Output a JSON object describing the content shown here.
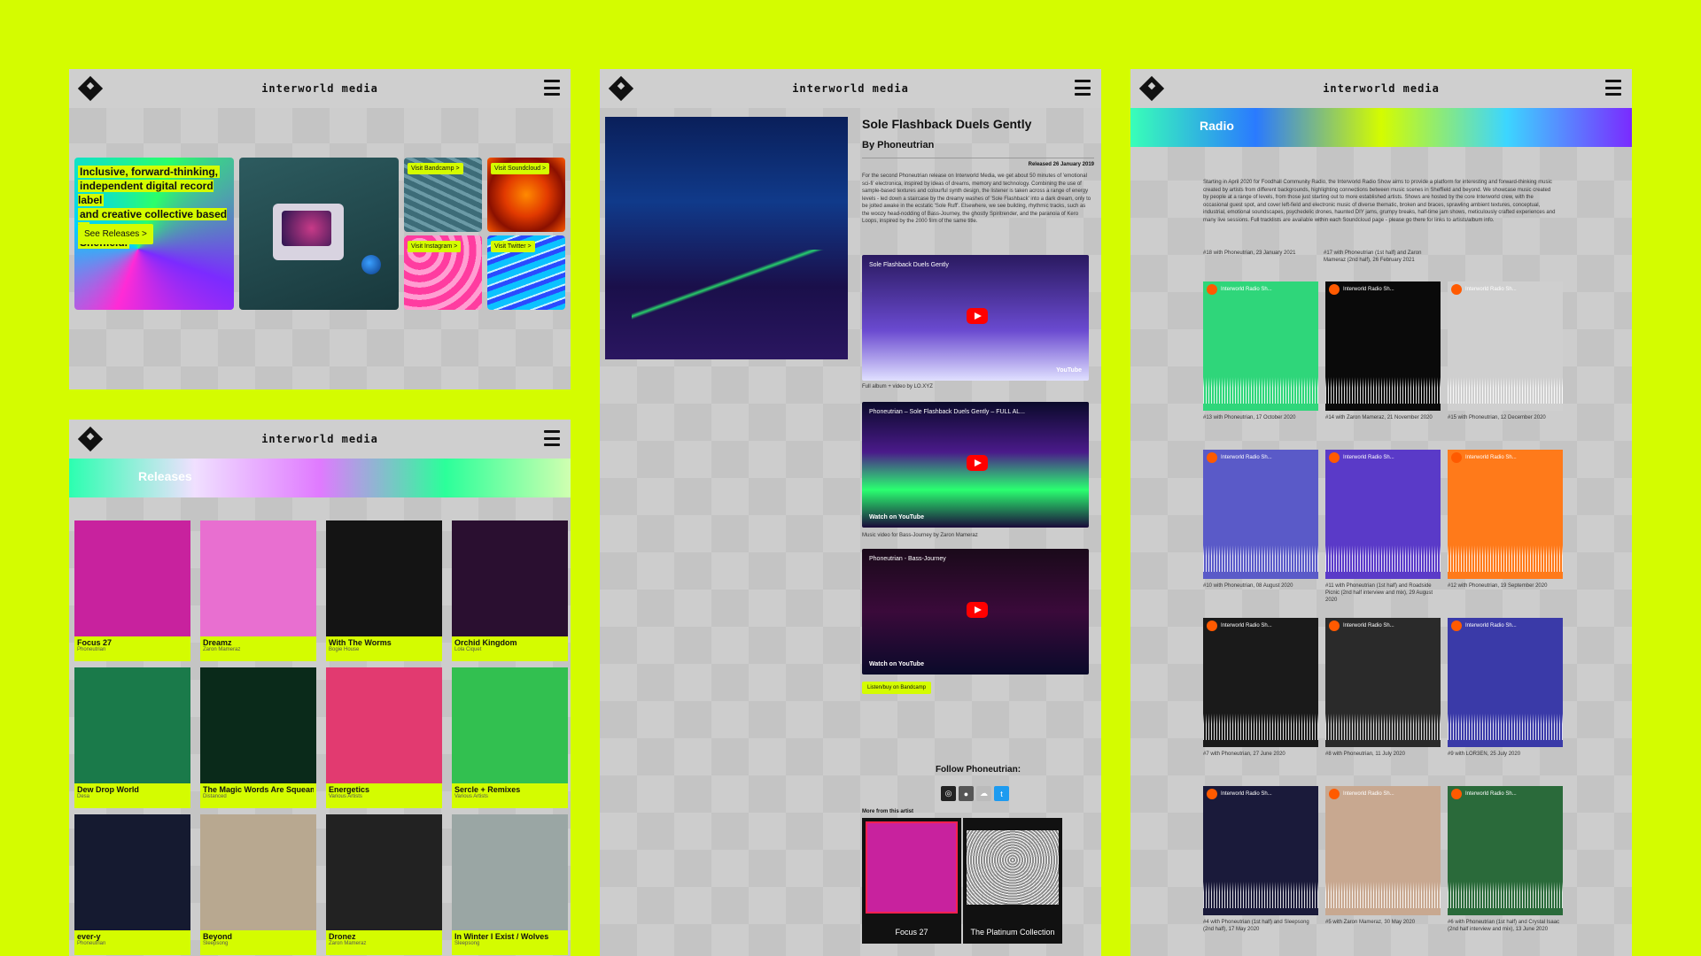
{
  "brand": "interworld media",
  "home": {
    "tagline_lines": [
      "Inclusive, forward-thinking,",
      "independent digital record label",
      "and creative collective based in",
      "Sheffield."
    ],
    "cta": "See Releases >",
    "links": {
      "bandcamp": "Visit Bandcamp >",
      "soundcloud": "Visit Soundcloud >",
      "instagram": "Visit Instagram >",
      "twitter": "Visit Twitter >"
    }
  },
  "releases": {
    "heading": "Releases",
    "items": [
      {
        "title": "Focus 27",
        "artist": "Phoneutrian",
        "color": "#c8229e"
      },
      {
        "title": "Dreamz",
        "artist": "Zaron Mameraz",
        "color": "#e86fd0"
      },
      {
        "title": "With The Worms",
        "artist": "Bogie House",
        "color": "#141414"
      },
      {
        "title": "Orchid Kingdom",
        "artist": "Lola Ciquet",
        "color": "#2a0f30"
      },
      {
        "title": "Dew Drop World",
        "artist": "Desa",
        "color": "#1a7a4a"
      },
      {
        "title": "The Magic Words Are Squeamish Ossifrage",
        "artist": "Distanced",
        "color": "#0a2a1a"
      },
      {
        "title": "Energetics",
        "artist": "Various Artists",
        "color": "#e23a70"
      },
      {
        "title": "Sercle + Remixes",
        "artist": "Various Artists",
        "color": "#32c050"
      },
      {
        "title": "ever-y",
        "artist": "Phoneutrian",
        "color": "#151a30"
      },
      {
        "title": "Beyond",
        "artist": "Sleepsong",
        "color": "#b8a890"
      },
      {
        "title": "Dronez",
        "artist": "Zaron Mameraz",
        "color": "#222"
      },
      {
        "title": "In Winter I Exist / Wolves",
        "artist": "Sleepsong",
        "color": "#9aa6a4"
      }
    ]
  },
  "album": {
    "title": "Sole Flashback Duels Gently",
    "by": "By Phoneutrian",
    "released": "Released 26 January 2019",
    "description": "For the second Phoneutrian release on Interworld Media, we get about 50 minutes of 'emotional sci-fi' electronica, inspired by ideas of dreams, memory and technology. Combining the use of sample-based textures and colourful synth design, the listener is taken across a range of energy levels - led down a staircase by the dreamy washes of 'Sole Flashback' into a dark dream, only to be jolted awake in the ecstatic 'Sole Ruff'. Elsewhere, we see building, rhythmic tracks, such as the woozy head-nodding of Bass-Journey, the ghostly Spiritrender, and the paranoia of Kero Loops, inspired by the 2000 film of the same title.",
    "videos": [
      {
        "title": "Sole Flashback Duels Gently",
        "caption": "Full album + video by LO.XYZ",
        "footer": "YouTube"
      },
      {
        "title": "Phoneutrian – Sole Flashback Duels Gently – FULL AL...",
        "caption": "Music video for Bass-Journey by Zaron Mameraz",
        "footer": "Watch on YouTube"
      },
      {
        "title": "Phoneutrian - Bass-Journey",
        "caption": "",
        "footer": "Watch on YouTube"
      }
    ],
    "bandcamp_cta": "Listen/buy on Bandcamp",
    "follow": "Follow Phoneutrian:",
    "socials": [
      "instagram-icon",
      "vinyl-icon",
      "soundcloud-icon",
      "twitter-icon"
    ],
    "more_label": "More from this artist",
    "more": [
      {
        "title": "Focus 27",
        "color": "#c8229e"
      },
      {
        "title": "The Platinum Collection",
        "color": "#8c8c8c"
      }
    ]
  },
  "radio": {
    "heading": "Radio",
    "intro": "Starting in April 2020 for Foodhall Community Radio, the Interworld Radio Show aims to provide a platform for interesting and forward-thinking music created by artists from different backgrounds, highlighting connections between music scenes in Sheffield and beyond. We showcase music created by people at a range of levels, from those just starting out to more established artists. Shows are hosted by the core Interworld crew, with the occasional guest spot, and cover left-field and electronic music of diverse thematic, broken and braces, sprawling ambient textures, conceptual, industrial, emotional soundscapes, psychedelic drones, haunted DIY jams, grumpy breaks, half-time jam shows, meticulously crafted experiences and many live sessions. Full tracklists are available within each Soundcloud page - please go there for links to artists/album info.",
    "top_captions": [
      "#18 with Phoneutrian, 23 January 2021",
      "#17 with Phoneutrian (1st half) and Zaron Mameraz (2nd half), 26 February 2021"
    ],
    "episodes": [
      {
        "label": "Interworld Radio Sh...",
        "caption": "#13 with Phoneutrian, 17 October 2020",
        "color": "#2fd67a"
      },
      {
        "label": "Interworld Radio Sh...",
        "caption": "#14 with Zaron Mameraz, 21 November 2020",
        "color": "#0a0a0a"
      },
      {
        "label": "Interworld Radio Sh...",
        "caption": "#15 with Phoneutrian, 12 December 2020",
        "color": "#cfcfcf"
      },
      {
        "label": "Interworld Radio Sh...",
        "caption": "#10 with Phoneutrian, 08 August 2020",
        "color": "#5a5ac8"
      },
      {
        "label": "Interworld Radio Sh...",
        "caption": "#11 with Phoneutrian (1st half) and Roadside Picnic (2nd half interview and mix), 29 August 2020",
        "color": "#5a3ac8"
      },
      {
        "label": "Interworld Radio Sh...",
        "caption": "#12 with Phoneutrian, 19 September 2020",
        "color": "#ff7a1a"
      },
      {
        "label": "Interworld Radio Sh...",
        "caption": "#7 with Phoneutrian, 27 June 2020",
        "color": "#1a1a1a"
      },
      {
        "label": "Interworld Radio Sh...",
        "caption": "#8 with Phoneutrian, 11 July 2020",
        "color": "#2a2a2a"
      },
      {
        "label": "Interworld Radio Sh...",
        "caption": "#9 with LOR3EN, 25 July 2020",
        "color": "#3a3aa8"
      },
      {
        "label": "Interworld Radio Sh...",
        "caption": "#4 with Phoneutrian (1st half) and Sleepsong (2nd half), 17 May 2020",
        "color": "#1a1a3a"
      },
      {
        "label": "Interworld Radio Sh...",
        "caption": "#5 with Zaron Mameraz, 30 May 2020",
        "color": "#c8a890"
      },
      {
        "label": "Interworld Radio Sh...",
        "caption": "#6 with Phoneutrian (1st half) and Crystal Isaac (2nd half interview and mix), 13 June 2020",
        "color": "#2a6a3a"
      }
    ]
  }
}
